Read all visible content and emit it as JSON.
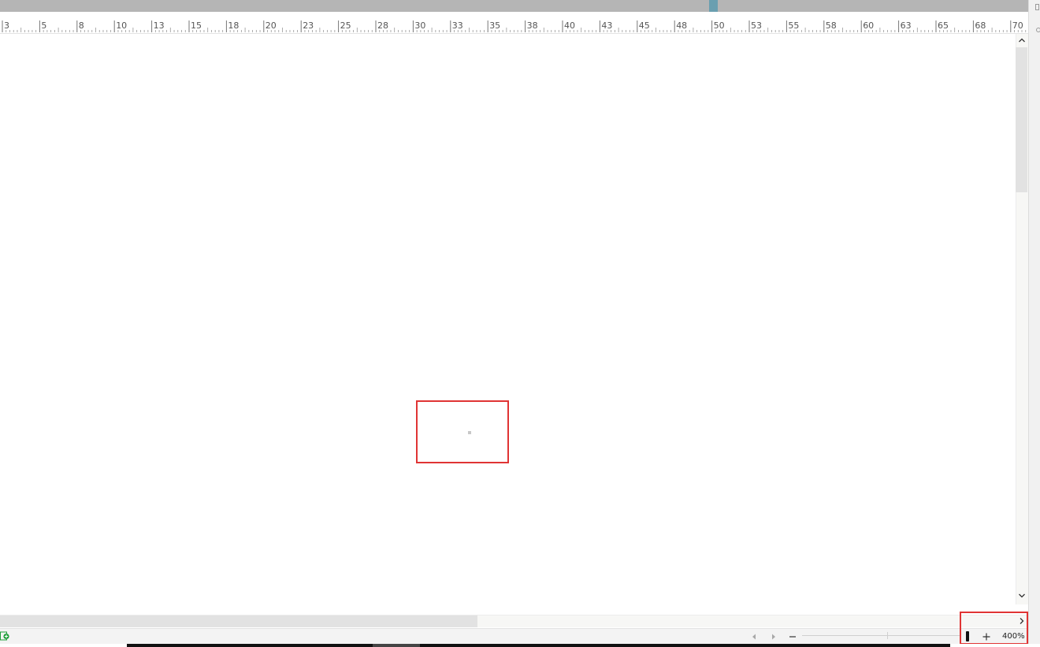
{
  "ruler": {
    "labels": [
      "3",
      "5",
      "8",
      "10",
      "13",
      "15",
      "18",
      "20",
      "23",
      "25",
      "28",
      "30",
      "33",
      "35",
      "38",
      "40",
      "43",
      "45",
      "48",
      "50",
      "53",
      "55",
      "58",
      "60",
      "63",
      "65",
      "68",
      "70"
    ]
  },
  "statusbar": {
    "zoom_value": "400%"
  },
  "icons": {
    "status": "sheet-add-icon",
    "prev": "triangle-left-icon",
    "next": "triangle-right-icon",
    "zoom_out": "minus-icon",
    "zoom_in": "plus-icon",
    "scroll_up": "chevron-up-icon",
    "scroll_down": "chevron-down-icon",
    "scroll_right": "chevron-right-icon"
  },
  "colors": {
    "highlight": "#e03434",
    "accent_marker": "#6a9fb0"
  }
}
